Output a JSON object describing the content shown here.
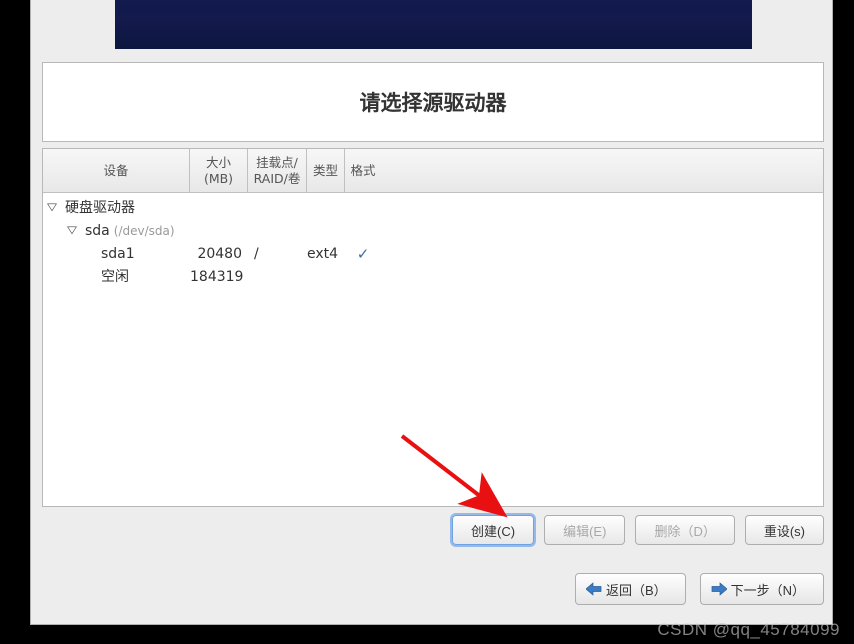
{
  "title": "请选择源驱动器",
  "columns": {
    "device": "设备",
    "size": "大小\n(MB)",
    "mount": "挂载点/\nRAID/卷",
    "type": "类型",
    "format": "格式"
  },
  "tree": {
    "root_label": "硬盘驱动器",
    "disk": {
      "name": "sda",
      "path": "(/dev/sda)"
    },
    "partitions": [
      {
        "name": "sda1",
        "size": "20480",
        "mount": "/",
        "type": "ext4",
        "format": true
      },
      {
        "name": "空闲",
        "size": "184319",
        "mount": "",
        "type": "",
        "format": false
      }
    ]
  },
  "buttons": {
    "create": "创建(C)",
    "edit": "编辑(E)",
    "delete": "删除（D）",
    "reset": "重设(s)",
    "back": "返回（B）",
    "next": "下一步（N）"
  },
  "watermark": "CSDN @qq_45784099"
}
